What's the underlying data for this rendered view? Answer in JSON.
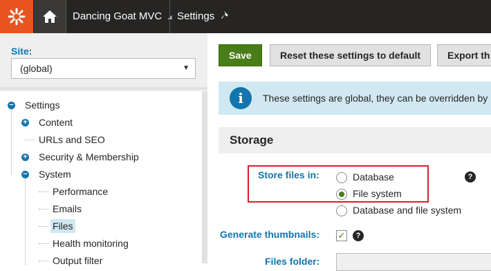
{
  "topbar": {
    "site_name": "Dancing Goat MVC",
    "app_name": "Settings",
    "icons": {
      "logo": "kentico-logo-icon",
      "home": "home-icon",
      "caret": "caret-down-icon",
      "pin": "pin-icon"
    }
  },
  "sidebar": {
    "site_label": "Site:",
    "site_value": "(global)",
    "tree": [
      {
        "label": "Settings",
        "level": 0,
        "expander": "collapse"
      },
      {
        "label": "Content",
        "level": 1,
        "expander": "expand"
      },
      {
        "label": "URLs and SEO",
        "level": 1,
        "expander": "none"
      },
      {
        "label": "Security & Membership",
        "level": 1,
        "expander": "expand"
      },
      {
        "label": "System",
        "level": 1,
        "expander": "collapse"
      },
      {
        "label": "Performance",
        "level": 2,
        "expander": "none"
      },
      {
        "label": "Emails",
        "level": 2,
        "expander": "none"
      },
      {
        "label": "Files",
        "level": 2,
        "expander": "none",
        "selected": true
      },
      {
        "label": "Health monitoring",
        "level": 2,
        "expander": "none"
      },
      {
        "label": "Output filter",
        "level": 2,
        "expander": "none"
      }
    ]
  },
  "toolbar": {
    "save": "Save",
    "reset": "Reset these settings to default",
    "export": "Export th"
  },
  "info": {
    "text": "These settings are global, they can be overridden by i"
  },
  "category": {
    "title": "Storage"
  },
  "fields": {
    "store_files": {
      "label": "Store files in:",
      "options": [
        "Database",
        "File system",
        "Database and file system"
      ],
      "selected": "File system"
    },
    "thumbnails": {
      "label": "Generate thumbnails:",
      "checked": true,
      "check_glyph": "✓"
    },
    "folder": {
      "label": "Files folder:",
      "value": ""
    },
    "help_glyph": "?"
  },
  "colors": {
    "accent": "#1175ae",
    "primary_button": "#497d1a",
    "logo_bg": "#e8541f",
    "highlight_box": "#d0232e"
  }
}
